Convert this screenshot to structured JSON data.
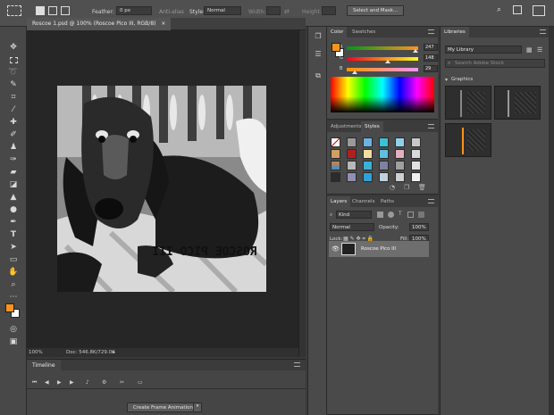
{
  "options_bar": {
    "feather_label": "Feather:",
    "feather_value": "0 px",
    "anti_alias_label": "Anti-alias",
    "style_label": "Style:",
    "style_value": "Normal",
    "width_label": "Width:",
    "height_label": "Height:",
    "select_mask_label": "Select and Mask..."
  },
  "document": {
    "tab_title": "Roscoe 1.psd @ 100% (Roscoe Pico III, RGB/8)",
    "zoom": "100%",
    "doc_size": "Doc: 546.8K/729.0K",
    "artwork_caption": "ROSCOE PICO III"
  },
  "timeline": {
    "tab_label": "Timeline",
    "create_button": "Create Frame Animation"
  },
  "color_panel": {
    "tabs": [
      "Color",
      "Swatches"
    ],
    "r_label": "R",
    "g_label": "G",
    "b_label": "B",
    "r_value": "247",
    "g_value": "148",
    "b_value": "29",
    "r": 247,
    "g": 148,
    "b": 29,
    "foreground_color": "#f7941d",
    "background_color": "#ffffff"
  },
  "styles_panel": {
    "tabs": [
      "Adjustments",
      "Styles"
    ]
  },
  "layers_panel": {
    "tabs": [
      "Layers",
      "Channels",
      "Paths"
    ],
    "filter_kind": "Kind",
    "blend_mode": "Normal",
    "opacity_label": "Opacity:",
    "opacity_value": "100%",
    "lock_label": "Lock:",
    "fill_label": "Fill:",
    "fill_value": "100%",
    "layer_name": "Roscoe Pico III"
  },
  "libraries_panel": {
    "tab_label": "Libraries",
    "library_name": "My Library",
    "search_placeholder": "Search Adobe Stock",
    "section_label": "Graphics"
  }
}
